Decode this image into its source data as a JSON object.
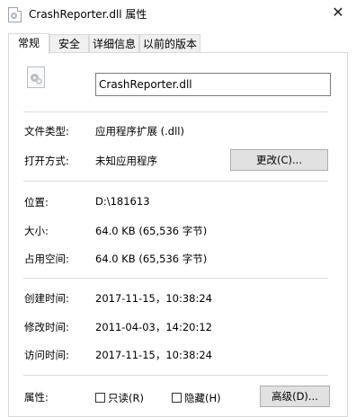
{
  "window": {
    "title": "CrashReporter.dll 属性",
    "close_glyph": "✕"
  },
  "tabs": [
    {
      "label": "常规",
      "active": true
    },
    {
      "label": "安全",
      "active": false
    },
    {
      "label": "详细信息",
      "active": false
    },
    {
      "label": "以前的版本",
      "active": false
    }
  ],
  "general": {
    "file_name": "CrashReporter.dll",
    "file_type_label": "文件类型:",
    "file_type_value": "应用程序扩展 (.dll)",
    "opens_with_label": "打开方式:",
    "opens_with_value": "未知应用程序",
    "change_button": "更改(C)...",
    "location_label": "位置:",
    "location_value": "D:\\181613",
    "size_label": "大小:",
    "size_value": "64.0 KB (65,536 字节)",
    "size_on_disk_label": "占用空间:",
    "size_on_disk_value": "64.0 KB (65,536 字节)",
    "created_label": "创建时间:",
    "created_value": "2017-11-15，10:38:24",
    "modified_label": "修改时间:",
    "modified_value": "2011-04-03，14:20:12",
    "accessed_label": "访问时间:",
    "accessed_value": "2017-11-15，10:38:24",
    "attributes_label": "属性:",
    "readonly_label": "只读(R)",
    "readonly_checked": false,
    "hidden_label": "隐藏(H)",
    "hidden_checked": false,
    "advanced_button": "高级(D)..."
  },
  "icons": {
    "title": "dll-file-icon",
    "file": "dll-file-icon"
  }
}
